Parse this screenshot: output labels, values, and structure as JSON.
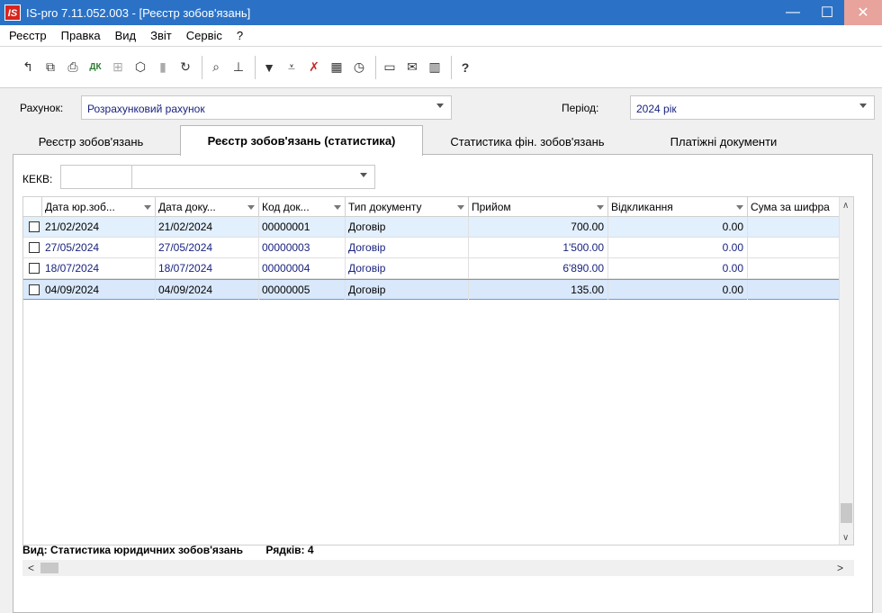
{
  "window": {
    "logo": "IS",
    "title": "IS-pro 7.11.052.003 - [Реєстр зобов'язань]",
    "min_label": "—",
    "max_label": "☐",
    "close_label": "✕"
  },
  "menu": [
    "Реєстр",
    "Правка",
    "Вид",
    "Звіт",
    "Сервіс",
    "?"
  ],
  "toolbar_icons": [
    "new-doc-icon",
    "copy-icon",
    "print-icon",
    "dk-icon",
    "calc-icon",
    "package-icon",
    "stack-icon",
    "refresh-icon",
    "search-icon",
    "tree-icon",
    "filter-icon",
    "filter-set-icon",
    "filter-clear-icon",
    "table-icon",
    "calendar-icon",
    "form-icon",
    "mail-icon",
    "columns-icon",
    "help-icon"
  ],
  "filters": {
    "account_label": "Рахунок:",
    "account_value": "Розрахунковий рахунок",
    "period_label": "Період:",
    "period_value": "2024 рік"
  },
  "tabs": [
    {
      "label": "Реєстр зобов'язань",
      "active": false
    },
    {
      "label": "Реєстр зобов'язань (статистика)",
      "active": true
    },
    {
      "label": "Статистика фін. зобов'язань",
      "active": false
    },
    {
      "label": "Платіжні документи",
      "active": false
    }
  ],
  "kekv": {
    "label": "КЕКВ:",
    "code": "",
    "value": ""
  },
  "table": {
    "columns": [
      "Дата юр.зоб...",
      "Дата доку...",
      "Код док...",
      "Тип документу",
      "Прийом",
      "Відкликання",
      "Сума за шифра"
    ],
    "rows": [
      {
        "legal_date": "21/02/2024",
        "doc_date": "21/02/2024",
        "code": "00000001",
        "type": "Договір",
        "accepted": "700.00",
        "withdrawn": "0.00",
        "sum": ""
      },
      {
        "legal_date": "27/05/2024",
        "doc_date": "27/05/2024",
        "code": "00000003",
        "type": "Договір",
        "accepted": "1'500.00",
        "withdrawn": "0.00",
        "sum": ""
      },
      {
        "legal_date": "18/07/2024",
        "doc_date": "18/07/2024",
        "code": "00000004",
        "type": "Договір",
        "accepted": "6'890.00",
        "withdrawn": "0.00",
        "sum": ""
      },
      {
        "legal_date": "04/09/2024",
        "doc_date": "04/09/2024",
        "code": "00000005",
        "type": "Договір",
        "accepted": "135.00",
        "withdrawn": "0.00",
        "sum": ""
      }
    ]
  },
  "status": {
    "view": "Вид: Статистика юридичних зобов'язань",
    "rows": "Рядків: 4"
  },
  "scroll": {
    "up": "∧",
    "down": "∨",
    "left": "<",
    "right": ">"
  }
}
